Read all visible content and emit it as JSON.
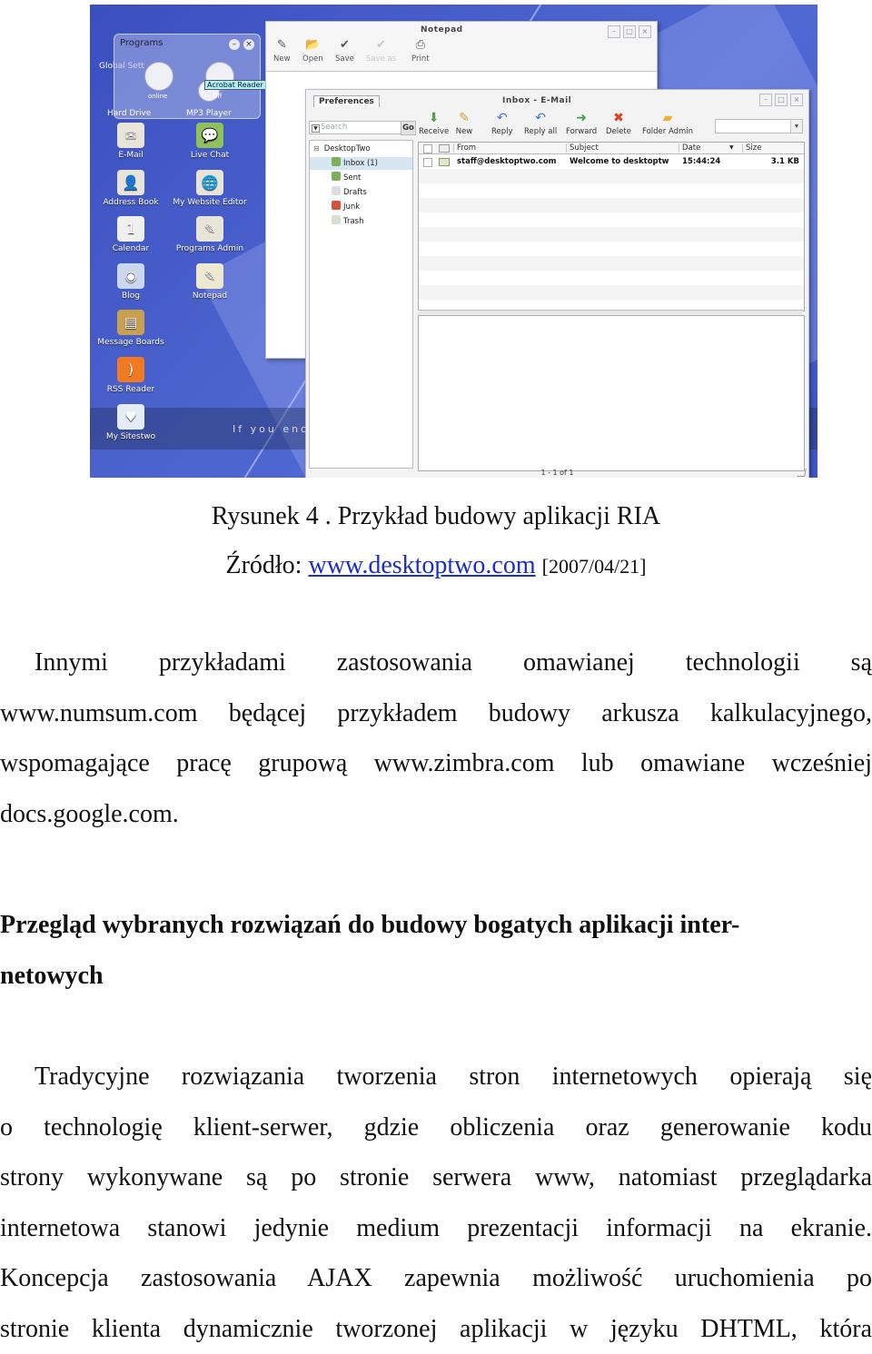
{
  "figure": {
    "desktop": {
      "programs_panel": {
        "title": "Programs",
        "minimize": "–",
        "close": "×",
        "items": [
          "online",
          "Off"
        ],
        "tooltip": "Acrobat Reader"
      },
      "background_labels": {
        "global_settings": "Global Sett",
        "hard_drive": "Hard Drive",
        "mp3_player": "MP3 Player"
      },
      "icons": [
        {
          "label": "E-Mail",
          "icon": "email-icon",
          "glyph": "✉",
          "color": "#e8e4d8"
        },
        {
          "label": "Live Chat",
          "icon": "chat-icon",
          "glyph": "💬",
          "color": "#8fc25a"
        },
        {
          "label": "Address Book",
          "icon": "address-book-icon",
          "glyph": "👤",
          "color": "#e8e4d8"
        },
        {
          "label": "My Website Editor",
          "icon": "website-editor-icon",
          "glyph": "🌐",
          "color": "#e8e4d8"
        },
        {
          "label": "Calendar",
          "icon": "calendar-icon",
          "glyph": "1",
          "color": "#f0f0f0"
        },
        {
          "label": "Programs Admin",
          "icon": "programs-admin-icon",
          "glyph": "✎",
          "color": "#e8e4d8"
        },
        {
          "label": "Blog",
          "icon": "blog-icon",
          "glyph": "◉",
          "color": "#c9d8ee"
        },
        {
          "label": "Notepad",
          "icon": "notepad-icon",
          "glyph": "✎",
          "color": "#efe8d0"
        },
        {
          "label": "Message Boards",
          "icon": "message-boards-icon",
          "glyph": "▤",
          "color": "#c9a050"
        },
        {
          "label": "RSS Reader",
          "icon": "rss-icon",
          "glyph": ")",
          "color": "#ef7a22"
        },
        {
          "label": "My Sitestwo",
          "icon": "sitestwo-icon",
          "glyph": "♥",
          "color": "#e6ecf4"
        }
      ],
      "banner_text": "If you enc"
    },
    "notepad": {
      "title": "Notepad",
      "toolbar": [
        {
          "label": "New",
          "icon": "new-icon",
          "glyph": "✎"
        },
        {
          "label": "Open",
          "icon": "open-folder-icon",
          "glyph": "📂"
        },
        {
          "label": "Save",
          "icon": "save-icon",
          "glyph": "✔"
        },
        {
          "label": "Save as",
          "icon": "save-as-icon",
          "glyph": "✔"
        },
        {
          "label": "Print",
          "icon": "print-icon",
          "glyph": "⎙"
        }
      ]
    },
    "mail": {
      "title": "Inbox - E-Mail",
      "preferences_tab": "Preferences",
      "search_placeholder": "Search",
      "go_label": "Go",
      "tree": {
        "root": "DesktopTwo",
        "folders": [
          {
            "label": "Inbox (1)",
            "icon": "inbox-icon",
            "color": "#7bb05a",
            "selected": true
          },
          {
            "label": "Sent",
            "icon": "sent-icon",
            "color": "#7bb05a",
            "selected": false
          },
          {
            "label": "Drafts",
            "icon": "drafts-icon",
            "color": "#dddddd",
            "selected": false
          },
          {
            "label": "Junk",
            "icon": "junk-icon",
            "color": "#d9503a",
            "selected": false
          },
          {
            "label": "Trash",
            "icon": "trash-icon",
            "color": "#d6dfd0",
            "selected": false
          }
        ]
      },
      "toolbar": [
        {
          "label": "Receive",
          "icon": "receive-icon",
          "glyph": "⬇",
          "color": "#5aa04a"
        },
        {
          "label": "New",
          "icon": "new-mail-icon",
          "glyph": "✎",
          "color": "#d9a030"
        },
        {
          "label": "Reply",
          "icon": "reply-icon",
          "glyph": "↶",
          "color": "#3a78c8"
        },
        {
          "label": "Reply all",
          "icon": "reply-all-icon",
          "glyph": "↶",
          "color": "#3a78c8"
        },
        {
          "label": "Forward",
          "icon": "forward-icon",
          "glyph": "➜",
          "color": "#3aa040"
        },
        {
          "label": "Delete",
          "icon": "delete-icon",
          "glyph": "✖",
          "color": "#e04020"
        },
        {
          "label": "Folder Admin",
          "icon": "folder-admin-icon",
          "glyph": "▰",
          "color": "#f0b030"
        }
      ],
      "columns": [
        "From",
        "Subject",
        "Date",
        "Size"
      ],
      "messages": [
        {
          "from": "staff@desktoptwo.com",
          "subject": "Welcome to desktoptw",
          "date": "15:44:24",
          "size": "3.1 KB"
        }
      ],
      "status": "1 - 1 of 1"
    }
  },
  "caption": {
    "title": "Rysunek 4 . Przykład budowy aplikacji RIA",
    "source_label": "Źródło: ",
    "source_link": "www.desktoptwo.com",
    "source_date": "[2007/04/21]"
  },
  "paragraph1": {
    "lines": [
      "Innymi przykładami zastosowania omawianej technologii są",
      "www.numsum.com będącej przykładem budowy arkusza kalkulacyjnego,",
      "wspomagające pracę grupową www.zimbra.com lub omawiane wcześniej",
      "docs.google.com."
    ]
  },
  "heading": {
    "lines": [
      "Przegląd wybranych rozwiązań do budowy bogatych aplikacji inter-",
      "netowych"
    ]
  },
  "paragraph2": {
    "lines": [
      "Tradycyjne rozwiązania tworzenia stron internetowych opierają się",
      "o technologię klient-serwer, gdzie obliczenia oraz generowanie kodu",
      "strony wykonywane są po stronie serwera www, natomiast przeglądarka",
      "internetowa stanowi jedynie medium prezentacji informacji na ekranie.",
      "Koncepcja zastosowania AJAX zapewnia możliwość uruchomienia po",
      "stronie klienta dynamicznie tworzonej aplikacji w języku DHTML, która"
    ]
  }
}
